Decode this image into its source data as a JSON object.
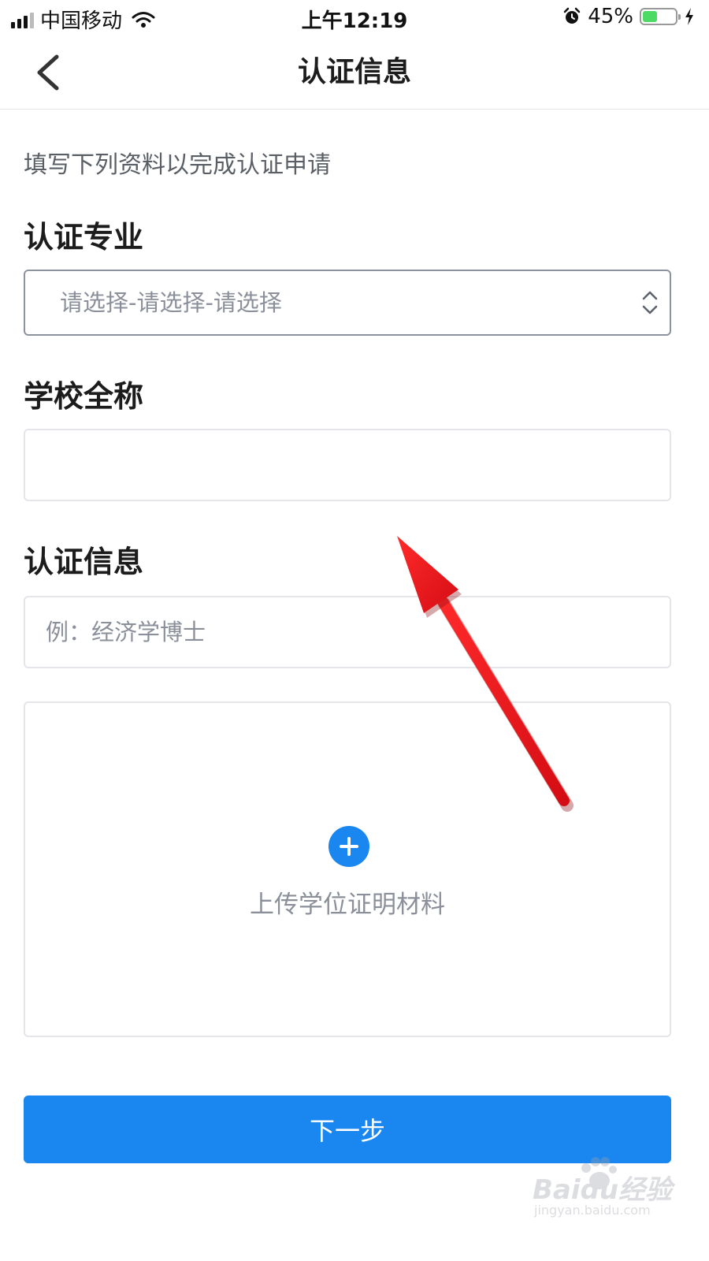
{
  "status_bar": {
    "carrier": "中国移动",
    "time": "上午12:19",
    "battery_percent": "45%",
    "battery_level": 0.45,
    "icons": [
      "signal-icon",
      "wifi-icon",
      "alarm-icon",
      "battery-icon",
      "charging-icon"
    ]
  },
  "nav": {
    "title": "认证信息",
    "back_icon": "chevron-left-icon"
  },
  "form": {
    "intro": "填写下列资料以完成认证申请",
    "major": {
      "label": "认证专业",
      "value": "请选择-请选择-请选择",
      "icon": "chevron-up-down-icon"
    },
    "school": {
      "label": "学校全称",
      "value": "",
      "placeholder": ""
    },
    "info": {
      "label": "认证信息",
      "value": "",
      "placeholder": "例：经济学博士"
    },
    "upload": {
      "label": "上传学位证明材料",
      "icon": "plus-icon"
    }
  },
  "next_button": "下一步",
  "annotation": {
    "icon": "red-arrow-icon",
    "color": "#e8141c"
  },
  "watermark": {
    "brand": "Baidu经验",
    "url": "jingyan.baidu.com"
  },
  "colors": {
    "accent": "#1a86f0",
    "text_primary": "#1c1c1c",
    "text_muted": "#8a8f99",
    "border": "#e3e5e8"
  }
}
